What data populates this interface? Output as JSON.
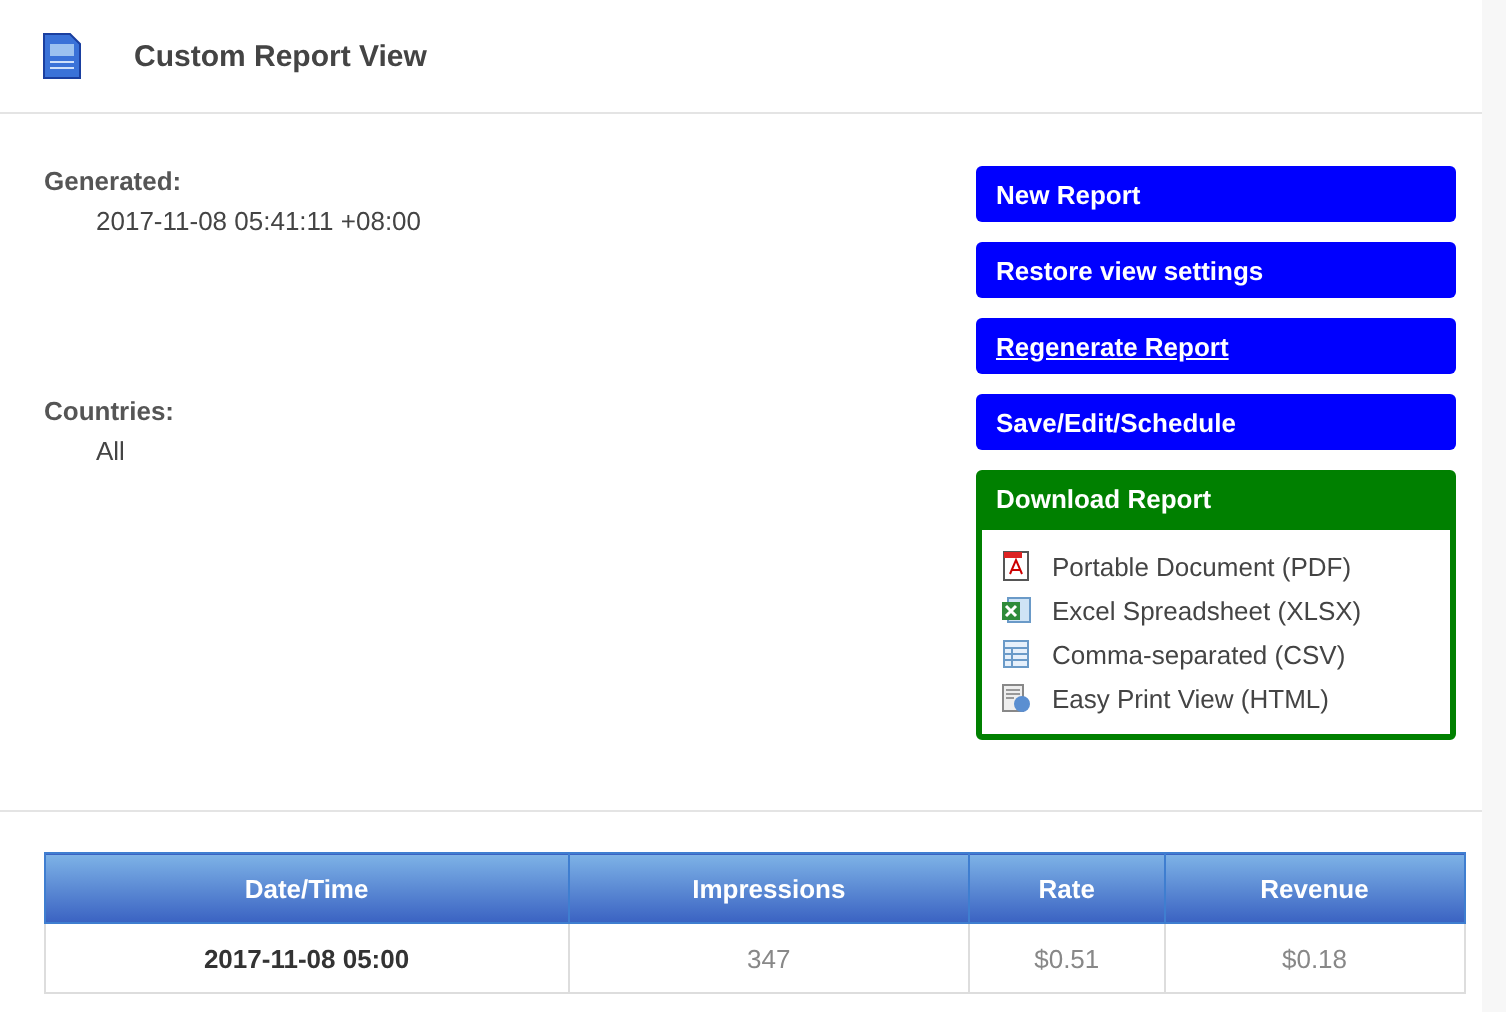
{
  "header": {
    "title": "Custom Report View"
  },
  "info": [
    {
      "label": "Generated:",
      "value": "2017-11-08 05:41:11 +08:00"
    },
    {
      "label": "Countries:",
      "value": "All"
    }
  ],
  "actions": [
    {
      "label": "New Report",
      "underlined": false
    },
    {
      "label": "Restore view settings",
      "underlined": false
    },
    {
      "label": "Regenerate Report",
      "underlined": true
    },
    {
      "label": "Save/Edit/Schedule",
      "underlined": false
    }
  ],
  "download": {
    "title": "Download Report",
    "items": [
      {
        "kind": "pdf",
        "label": "Portable Document (PDF)"
      },
      {
        "kind": "xlsx",
        "label": "Excel Spreadsheet (XLSX)"
      },
      {
        "kind": "csv",
        "label": "Comma-separated (CSV)"
      },
      {
        "kind": "html",
        "label": "Easy Print View (HTML)"
      }
    ]
  },
  "table": {
    "columns": [
      "Date/Time",
      "Impressions",
      "Rate",
      "Revenue"
    ],
    "rows": [
      [
        "2017-11-08 05:00",
        "347",
        "$0.51",
        "$0.18"
      ]
    ]
  }
}
